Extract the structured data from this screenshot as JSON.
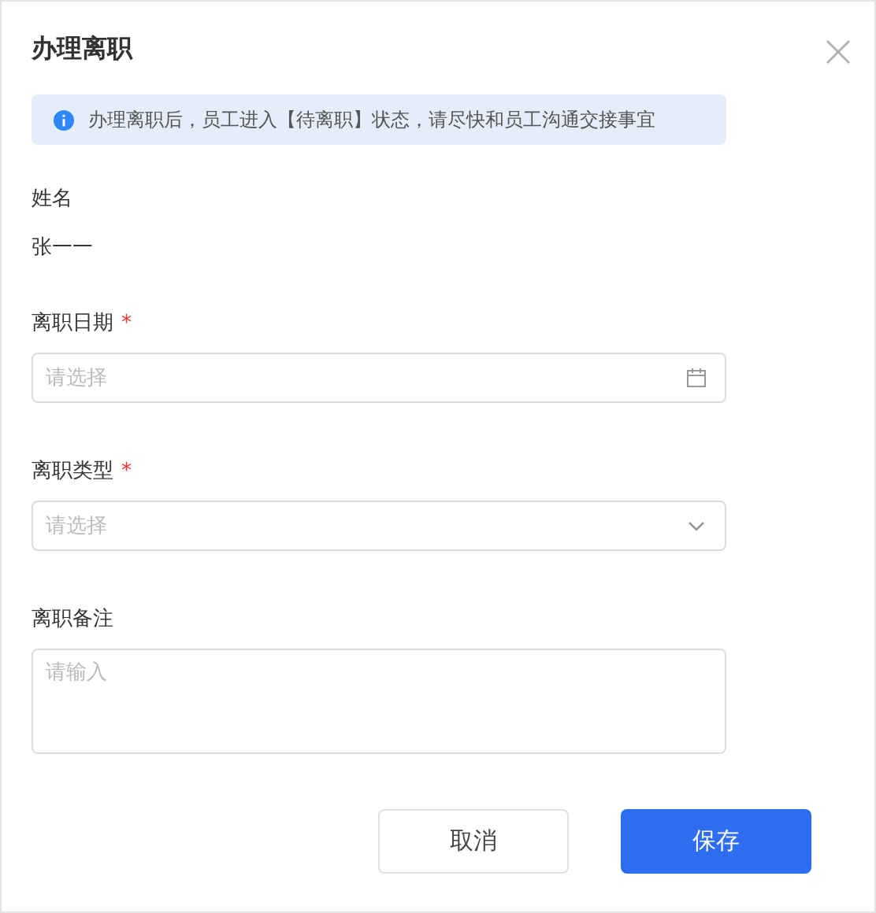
{
  "dialog": {
    "title": "办理离职"
  },
  "alert": {
    "text": "办理离职后，员工进入【待离职】状态，请尽快和员工沟通交接事宜"
  },
  "name_field": {
    "label": "姓名",
    "value": "张一一"
  },
  "fields": [
    {
      "kind": "date",
      "label": "离职日期",
      "required_mark": "*",
      "placeholder": "请选择"
    },
    {
      "kind": "select",
      "label": "离职类型",
      "required_mark": "*",
      "placeholder": "请选择"
    },
    {
      "kind": "textarea",
      "label": "离职备注",
      "placeholder": "请输入"
    }
  ],
  "buttons": [
    {
      "kind": "secondary",
      "label": "取消"
    },
    {
      "kind": "primary",
      "label": "保存"
    }
  ]
}
